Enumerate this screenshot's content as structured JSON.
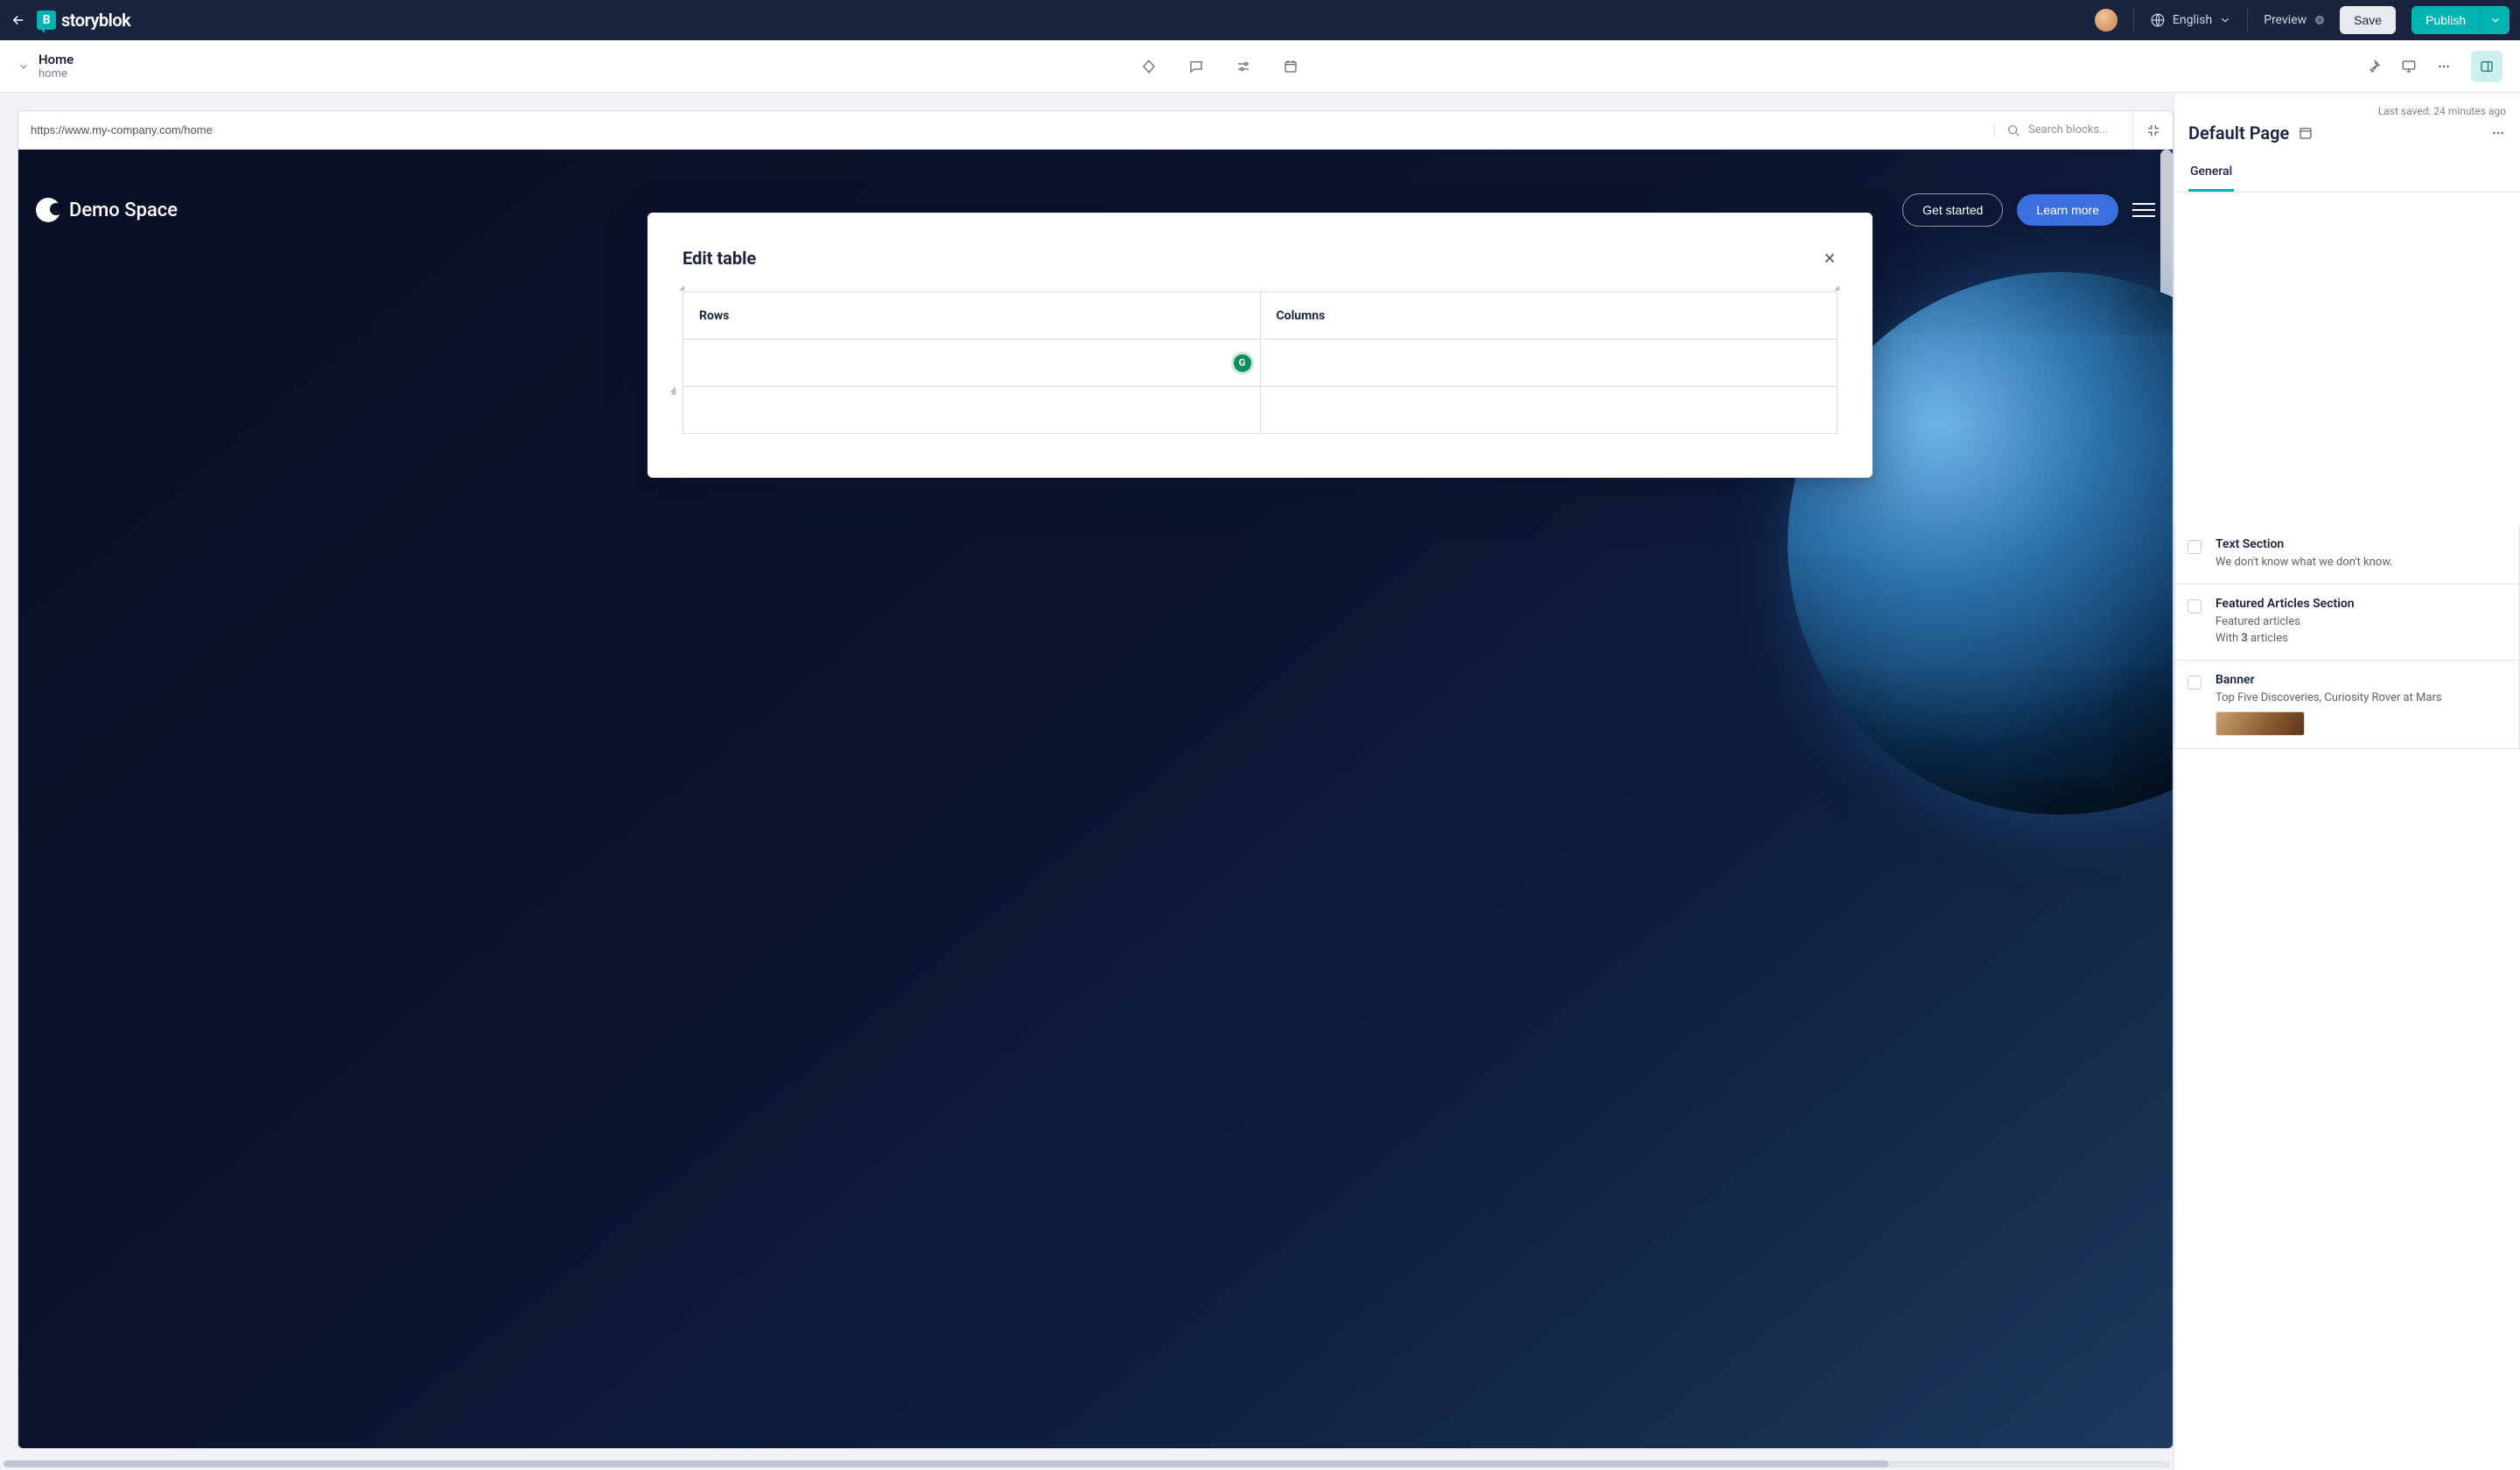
{
  "header": {
    "brand": "storyblok",
    "language": "English",
    "preview": "Preview",
    "save": "Save",
    "publish": "Publish"
  },
  "subbar": {
    "title": "Home",
    "slug": "home"
  },
  "canvas": {
    "url": "https://www.my-company.com/home",
    "search_placeholder": "Search blocks...",
    "demo_brand": "Demo Space",
    "get_started": "Get started",
    "learn_more": "Learn more"
  },
  "sidepanel": {
    "last_saved": "Last saved: 24 minutes ago",
    "title": "Default Page",
    "tab_general": "General",
    "blocks": [
      {
        "title": "Text Section",
        "subtitle": "We don't know what we don't know."
      },
      {
        "title": "Featured Articles Section",
        "line1": "Featured articles",
        "line2_pre": "With ",
        "line2_bold": "3",
        "line2_post": " articles"
      },
      {
        "title": "Banner",
        "subtitle": "Top Five Discoveries, Curiosity Rover at Mars"
      }
    ]
  },
  "modal": {
    "title": "Edit table",
    "col_rows": "Rows",
    "col_columns": "Columns",
    "grammarly": "G"
  }
}
